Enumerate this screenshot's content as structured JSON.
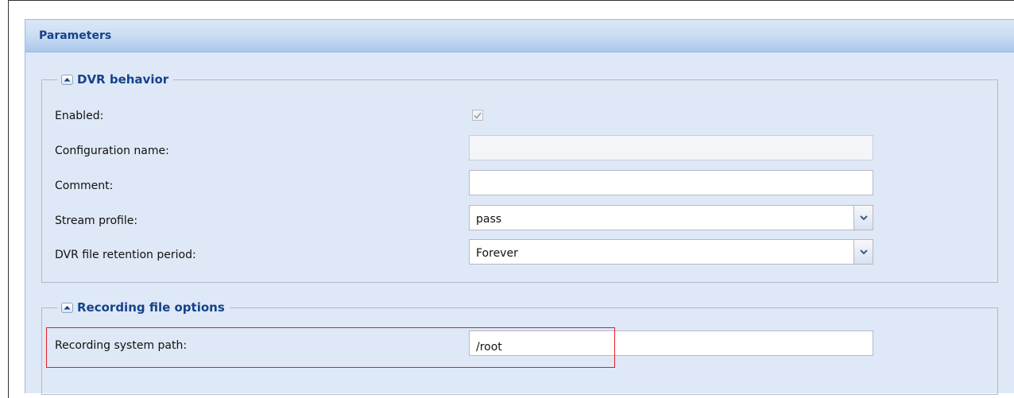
{
  "panel": {
    "title": "Parameters"
  },
  "dvr_behavior": {
    "legend": "DVR behavior",
    "enabled": {
      "label": "Enabled:",
      "checked": true
    },
    "configuration_name": {
      "label": "Configuration name:",
      "value": ""
    },
    "comment": {
      "label": "Comment:",
      "value": ""
    },
    "stream_profile": {
      "label": "Stream profile:",
      "value": "pass"
    },
    "retention_period": {
      "label": "DVR file retention period:",
      "value": "Forever"
    }
  },
  "recording_file_options": {
    "legend": "Recording file options",
    "system_path": {
      "label": "Recording system path:",
      "value": "/root"
    }
  },
  "icons": {
    "collapse": "chevron-up-icon",
    "dropdown": "chevron-down-icon",
    "check": "check-icon"
  },
  "colors": {
    "header_text": "#15428b",
    "panel_bg": "#dfe8f6",
    "highlight": "#e21f26"
  }
}
